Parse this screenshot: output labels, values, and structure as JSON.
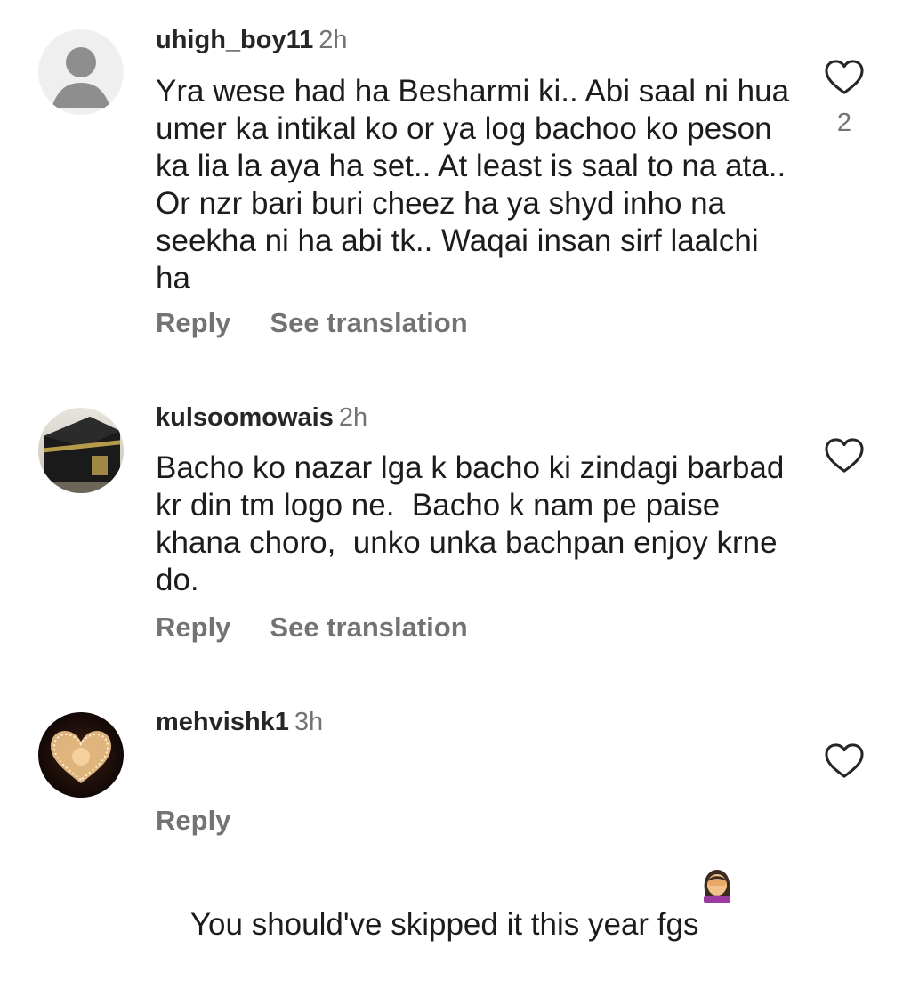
{
  "comments": [
    {
      "username": "uhigh_boy11",
      "time": "2h",
      "text": "Yra wese had ha Besharmi ki.. Abi saal ni hua umer ka intikal ko or ya log bachoo ko peson ka lia la aya ha set.. At least is saal to na ata.. Or nzr bari buri cheez ha ya shyd inho na seekha ni ha abi tk.. Waqai insan sirf laalchi ha",
      "likes": "2",
      "reply_label": "Reply",
      "translate_label": "See translation",
      "avatar_icon": "default-person-icon"
    },
    {
      "username": "kulsoomowais",
      "time": "2h",
      "text": "Bacho ko nazar lga k bacho ki zindagi barbad kr din tm logo ne.  Bacho k nam pe paise khana choro,  unko unka bachpan enjoy krne do.",
      "reply_label": "Reply",
      "translate_label": "See translation",
      "avatar_icon": "kaaba-photo"
    },
    {
      "username": "mehvishk1",
      "time": "3h",
      "text": "You should've skipped it this year fgs",
      "emoji": "woman-facepalming-emoji",
      "reply_label": "Reply",
      "avatar_icon": "heart-lights-photo"
    }
  ],
  "colors": {
    "text": "#262626",
    "secondary": "#737373",
    "heart_outline": "#262626"
  }
}
